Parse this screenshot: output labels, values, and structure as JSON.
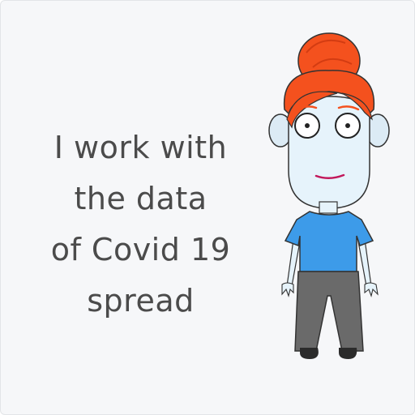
{
  "caption": {
    "lines": [
      "I work with",
      "the data",
      "of Covid 19",
      "spread"
    ]
  },
  "colors": {
    "background": "#f6f7f9",
    "text": "#4b4b4b",
    "hair": "#f4511e",
    "skin": "#e6f3fb",
    "shirt": "#3d9be9",
    "pants": "#6a6a6a",
    "shoes": "#2b2b2b"
  },
  "illustration": {
    "subject": "cartoon-woman-icon"
  }
}
